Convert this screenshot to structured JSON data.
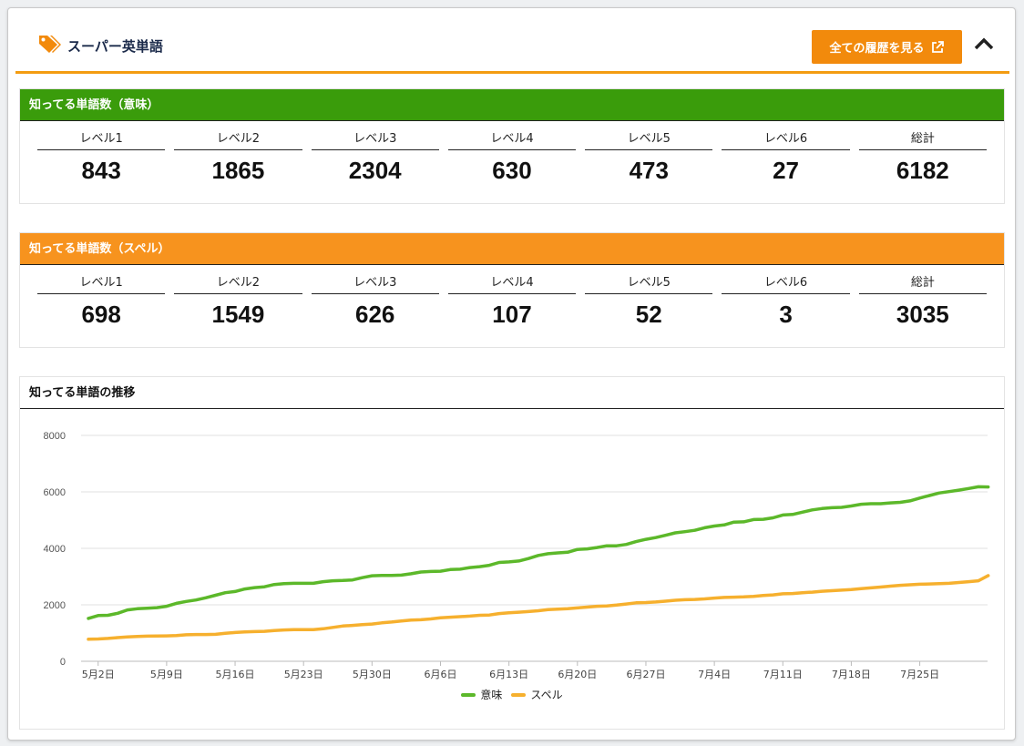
{
  "header": {
    "title": "スーパー英単語",
    "history_button_label": "全ての履歴を見る",
    "tag_icon": "tag-icon",
    "external_link_icon": "external-link-icon",
    "collapse_icon": "chevron-up-icon",
    "accent_color": "#f39c12"
  },
  "meaning_card": {
    "title": "知ってる単語数（意味）",
    "color": "#3a9c0b",
    "stats": [
      {
        "label": "レベル1",
        "value": "843"
      },
      {
        "label": "レベル2",
        "value": "1865"
      },
      {
        "label": "レベル3",
        "value": "2304"
      },
      {
        "label": "レベル4",
        "value": "630"
      },
      {
        "label": "レベル5",
        "value": "473"
      },
      {
        "label": "レベル6",
        "value": "27"
      },
      {
        "label": "総計",
        "value": "6182"
      }
    ]
  },
  "spell_card": {
    "title": "知ってる単語数（スペル）",
    "color": "#f7931e",
    "stats": [
      {
        "label": "レベル1",
        "value": "698"
      },
      {
        "label": "レベル2",
        "value": "1549"
      },
      {
        "label": "レベル3",
        "value": "626"
      },
      {
        "label": "レベル4",
        "value": "107"
      },
      {
        "label": "レベル5",
        "value": "52"
      },
      {
        "label": "レベル6",
        "value": "3"
      },
      {
        "label": "総計",
        "value": "3035"
      }
    ]
  },
  "chart_card": {
    "title": "知ってる単語の推移"
  },
  "chart_data": {
    "type": "line",
    "title": "",
    "xlabel": "",
    "ylabel": "",
    "ylim": [
      0,
      8000
    ],
    "yticks": [
      0,
      2000,
      4000,
      6000,
      8000
    ],
    "xticks": [
      "5月2日",
      "5月9日",
      "5月16日",
      "5月23日",
      "5月30日",
      "6月6日",
      "6月13日",
      "6月20日",
      "6月27日",
      "7月4日",
      "7月11日",
      "7月18日",
      "7月25日"
    ],
    "grid": true,
    "legend_position": "bottom",
    "x": [
      "5月1日",
      "5月2日",
      "5月3日",
      "5月4日",
      "5月5日",
      "5月6日",
      "5月7日",
      "5月8日",
      "5月9日",
      "5月10日",
      "5月11日",
      "5月12日",
      "5月13日",
      "5月14日",
      "5月15日",
      "5月16日",
      "5月17日",
      "5月18日",
      "5月19日",
      "5月20日",
      "5月21日",
      "5月22日",
      "5月23日",
      "5月24日",
      "5月25日",
      "5月26日",
      "5月27日",
      "5月28日",
      "5月29日",
      "5月30日",
      "5月31日",
      "6月1日",
      "6月2日",
      "6月3日",
      "6月4日",
      "6月5日",
      "6月6日",
      "6月7日",
      "6月8日",
      "6月9日",
      "6月10日",
      "6月11日",
      "6月12日",
      "6月13日",
      "6月14日",
      "6月15日",
      "6月16日",
      "6月17日",
      "6月18日",
      "6月19日",
      "6月20日",
      "6月21日",
      "6月22日",
      "6月23日",
      "6月24日",
      "6月25日",
      "6月26日",
      "6月27日",
      "6月28日",
      "6月29日",
      "6月30日",
      "7月1日",
      "7月2日",
      "7月3日",
      "7月4日",
      "7月5日",
      "7月6日",
      "7月7日",
      "7月8日",
      "7月9日",
      "7月10日",
      "7月11日",
      "7月12日",
      "7月13日",
      "7月14日",
      "7月15日",
      "7月16日",
      "7月17日",
      "7月18日",
      "7月19日",
      "7月20日",
      "7月21日",
      "7月22日",
      "7月23日",
      "7月24日",
      "7月25日",
      "7月26日",
      "7月27日",
      "7月28日",
      "7月29日",
      "7月30日",
      "7月31日"
    ],
    "series": [
      {
        "name": "意味",
        "color": "#5cb82a",
        "values": [
          1520,
          1620,
          1630,
          1700,
          1820,
          1860,
          1880,
          1900,
          1950,
          2050,
          2120,
          2170,
          2250,
          2340,
          2430,
          2470,
          2560,
          2610,
          2640,
          2720,
          2750,
          2760,
          2760,
          2760,
          2820,
          2850,
          2860,
          2880,
          2960,
          3030,
          3040,
          3040,
          3050,
          3100,
          3160,
          3180,
          3190,
          3250,
          3260,
          3320,
          3350,
          3400,
          3500,
          3520,
          3550,
          3640,
          3750,
          3810,
          3840,
          3860,
          3960,
          3980,
          4030,
          4090,
          4090,
          4140,
          4240,
          4320,
          4380,
          4460,
          4550,
          4590,
          4640,
          4730,
          4790,
          4830,
          4930,
          4940,
          5020,
          5030,
          5080,
          5180,
          5200,
          5280,
          5360,
          5410,
          5440,
          5450,
          5500,
          5560,
          5580,
          5580,
          5610,
          5630,
          5680,
          5780,
          5870,
          5960,
          6010,
          6060,
          6120,
          6182,
          6175
        ]
      },
      {
        "name": "スペル",
        "color": "#f6b02e",
        "values": [
          780,
          790,
          810,
          840,
          860,
          880,
          890,
          895,
          900,
          910,
          940,
          950,
          950,
          955,
          990,
          1020,
          1040,
          1050,
          1060,
          1090,
          1110,
          1120,
          1120,
          1120,
          1150,
          1200,
          1250,
          1270,
          1300,
          1320,
          1360,
          1390,
          1430,
          1460,
          1470,
          1500,
          1540,
          1560,
          1580,
          1600,
          1630,
          1640,
          1690,
          1720,
          1740,
          1760,
          1790,
          1830,
          1850,
          1860,
          1890,
          1920,
          1950,
          1960,
          1990,
          2030,
          2070,
          2080,
          2100,
          2130,
          2160,
          2180,
          2190,
          2210,
          2240,
          2260,
          2270,
          2280,
          2300,
          2330,
          2350,
          2390,
          2400,
          2430,
          2450,
          2480,
          2500,
          2520,
          2540,
          2570,
          2600,
          2630,
          2660,
          2690,
          2710,
          2730,
          2740,
          2750,
          2760,
          2790,
          2820,
          2850,
          3035
        ]
      }
    ]
  }
}
